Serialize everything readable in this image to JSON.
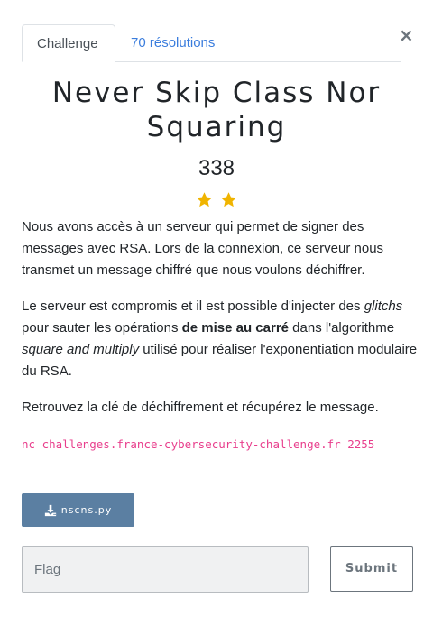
{
  "tabs": [
    {
      "label": "Challenge",
      "active": true
    },
    {
      "label": "70 résolutions",
      "active": false
    }
  ],
  "close_icon": "close-icon",
  "challenge": {
    "title": "Never Skip Class Nor Squaring",
    "value": "338",
    "stars": 2,
    "star_color": "#f0b400"
  },
  "description": {
    "p1": "Nous avons accès à un serveur qui permet de signer des messages avec RSA. Lors de la connexion, ce serveur nous transmet un message chiffré que nous voulons déchiffrer.",
    "p2_part1": "Le serveur est compromis et il est possible d'injecter des ",
    "p2_glitchs": "glitchs",
    "p2_part2": " pour sauter les opérations ",
    "p2_bold": "de mise au carré",
    "p2_part3": " dans l'algorithme ",
    "p2_italic": "square and multiply",
    "p2_part4": " utilisé pour réaliser l'exponentiation modulaire du RSA.",
    "p3": "Retrouvez la clé de déchiffrement et récupérez le message.",
    "command": "nc challenges.france-cybersecurity-challenge.fr 2255"
  },
  "download": {
    "label": "nscns.py",
    "icon": "download-icon"
  },
  "form": {
    "flag_placeholder": "Flag",
    "flag_value": "",
    "submit_label": "Submit"
  },
  "colors": {
    "link": "#3b7ddd",
    "code": "#e83e8c",
    "download_bg": "#5b7fa2"
  }
}
